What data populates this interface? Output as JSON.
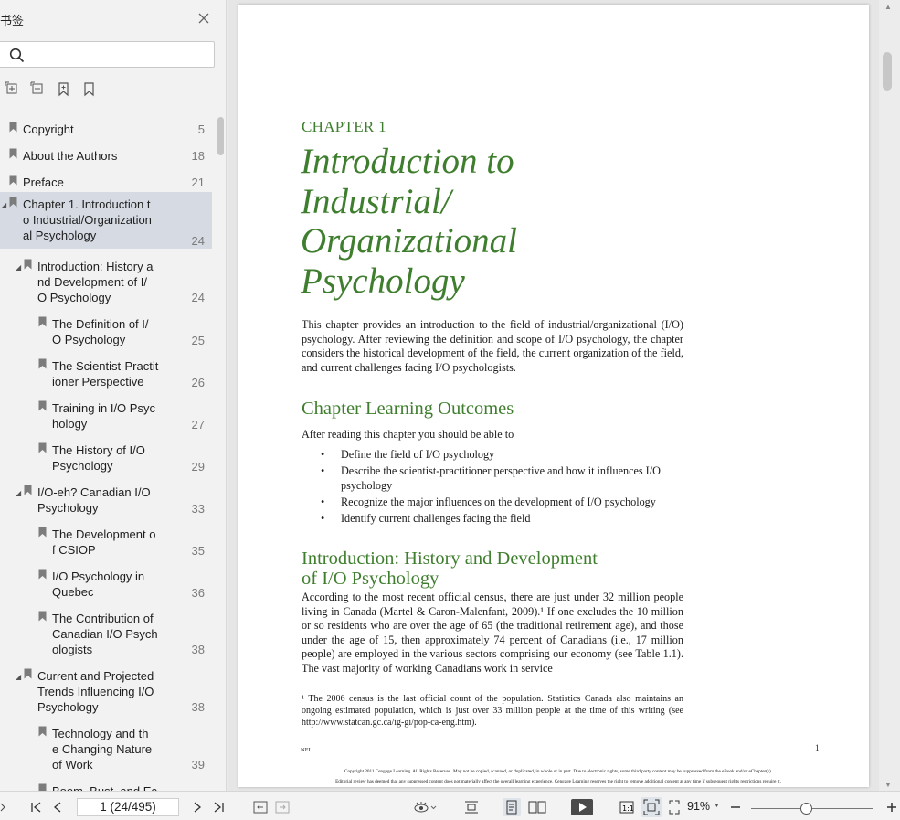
{
  "sidebar": {
    "title": "书签",
    "bookmarks": [
      {
        "label": "Copyright",
        "page": "5"
      },
      {
        "label": "About the Authors",
        "page": "18"
      },
      {
        "label": "Preface",
        "page": "21"
      },
      {
        "label": "Chapter 1. Introduction t\no Industrial/Organization\nal Psychology",
        "page": "24"
      },
      {
        "label": "Introduction: History a\nnd Development of I/\nO Psychology",
        "page": "24"
      },
      {
        "label": "The Definition of I/\nO Psychology",
        "page": "25"
      },
      {
        "label": "The Scientist-Practit\nioner Perspective",
        "page": "26"
      },
      {
        "label": "Training in I/O Psyc\nhology",
        "page": "27"
      },
      {
        "label": "The History of I/O\nPsychology",
        "page": "29"
      },
      {
        "label": "I/O-eh? Canadian I/O\nPsychology",
        "page": "33"
      },
      {
        "label": "The Development o\nf CSIOP",
        "page": "35"
      },
      {
        "label": "I/O Psychology in\nQuebec",
        "page": "36"
      },
      {
        "label": "The Contribution of\nCanadian I/O Psych\nologists",
        "page": "38"
      },
      {
        "label": "Current and Projected\nTrends Influencing I/O\nPsychology",
        "page": "38"
      },
      {
        "label": "Technology and th\ne Changing Nature\nof Work",
        "page": "39"
      },
      {
        "label": "Boom, Bust, and Ec",
        "page": ""
      }
    ]
  },
  "document": {
    "chapter_label": "CHAPTER 1",
    "chapter_title_lines": [
      "Introduction to",
      "Industrial/",
      "Organizational",
      "Psychology"
    ],
    "intro": "This chapter provides an introduction to the field of industrial/organizational (I/O) psychology. After reviewing the definition and scope of I/O psychology, the chapter considers the historical development of the field, the current organization of the field, and current challenges facing I/O psychologists.",
    "outcomes_heading": "Chapter Learning Outcomes",
    "outcomes_lead": "After reading this chapter you should be able to",
    "outcomes": [
      "Define the field of I/O psychology",
      "Describe the scientist-practitioner perspective and how it influences I/O psychology",
      "Recognize the major influences on the development of I/O psychology",
      "Identify current challenges facing the field"
    ],
    "section_heading_line1": "Introduction: History and Development",
    "section_heading_line2": "of I/O Psychology",
    "section_body": "According to the most recent official census, there are just under 32 million people living in Canada (Martel & Caron-Malenfant, 2009).¹ If one excludes the 10 million or so residents who are over the age of 65 (the traditional retirement age), and those under the age of 15, then approximately 74 percent of Canadians (i.e., 17 million people) are employed in the various sectors comprising our economy (see Table 1.1). The vast majority of working Canadians work in service",
    "footnote": "¹ The 2006 census is the last official count of the population. Statistics Canada also maintains an ongoing estimated population, which is just over 33 million people at the time of this writing (see http://www.statcan.gc.ca/ig-gi/pop-ca-eng.htm).",
    "nel": "NEL",
    "page_number": "1",
    "copyright_line1": "Copyright 2011 Cengage Learning. All Rights Reserved. May not be copied, scanned, or duplicated, in whole or in part. Due to electronic rights, some third party content may be suppressed from the eBook and/or eChapter(s).",
    "copyright_line2": "Editorial review has deemed that any suppressed content does not materially affect the overall learning experience. Cengage Learning reserves the right to remove additional content at any time if subsequent rights restrictions require it."
  },
  "statusbar": {
    "page_indicator": "1 (24/495)",
    "zoom": "91%"
  },
  "colors": {
    "heading_green": "#3f7e2e",
    "selected_bookmark": "#d6dbe3"
  }
}
